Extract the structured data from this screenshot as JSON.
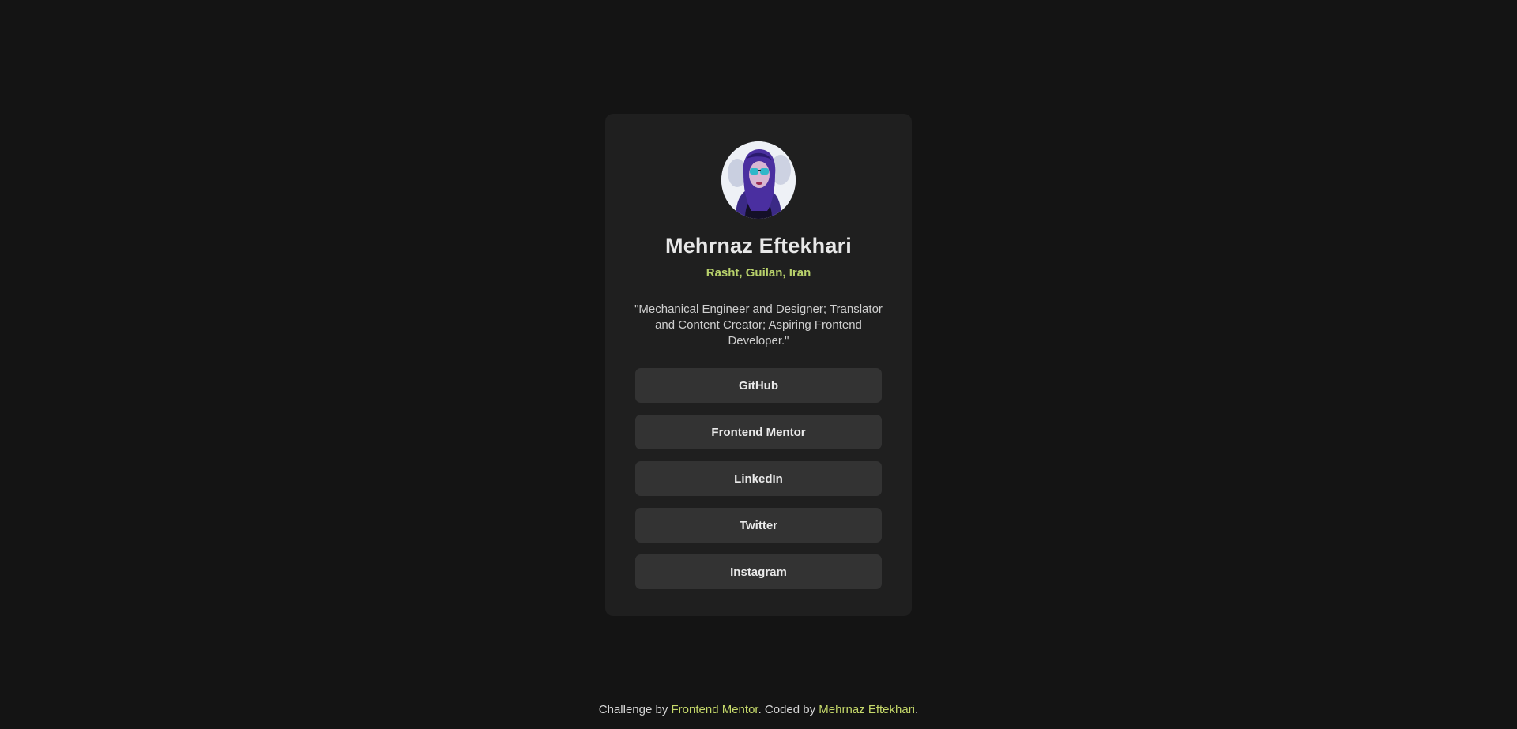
{
  "profile": {
    "avatar_alt": "",
    "name": "Mehrnaz Eftekhari",
    "location": "Rasht, Guilan, Iran",
    "bio": "\"Mechanical Engineer and Designer; Translator and Content Creator; Aspiring Frontend Developer.\""
  },
  "links": [
    {
      "label": "GitHub"
    },
    {
      "label": "Frontend Mentor"
    },
    {
      "label": "LinkedIn"
    },
    {
      "label": "Twitter"
    },
    {
      "label": "Instagram"
    }
  ],
  "footer": {
    "prefix": "Challenge by ",
    "challenge_link": "Frontend Mentor",
    "middle": ". Coded by ",
    "author_link": "Mehrnaz Eftekhari",
    "suffix": "."
  },
  "colors": {
    "background": "#141414",
    "card": "#1f1f1f",
    "button": "#333333",
    "accent": "#c5d86a"
  }
}
